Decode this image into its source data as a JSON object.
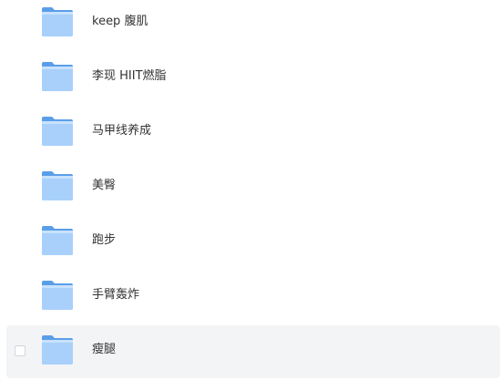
{
  "folders": [
    {
      "label": "keep 腹肌",
      "icon": "folder-icon"
    },
    {
      "label": "李现 HIIT燃脂",
      "icon": "folder-icon"
    },
    {
      "label": "马甲线养成",
      "icon": "folder-icon"
    },
    {
      "label": "美臀",
      "icon": "folder-icon"
    },
    {
      "label": "跑步",
      "icon": "folder-icon"
    },
    {
      "label": "手臂轰炸",
      "icon": "folder-icon"
    },
    {
      "label": "瘦腿",
      "icon": "folder-icon",
      "hovered": true
    }
  ],
  "colors": {
    "folder_back": "#5b9ee8",
    "folder_front": "#a8d0fb",
    "folder_front_top": "#c7e2fd",
    "hover_row": "#f3f4f6",
    "text": "#333333"
  }
}
